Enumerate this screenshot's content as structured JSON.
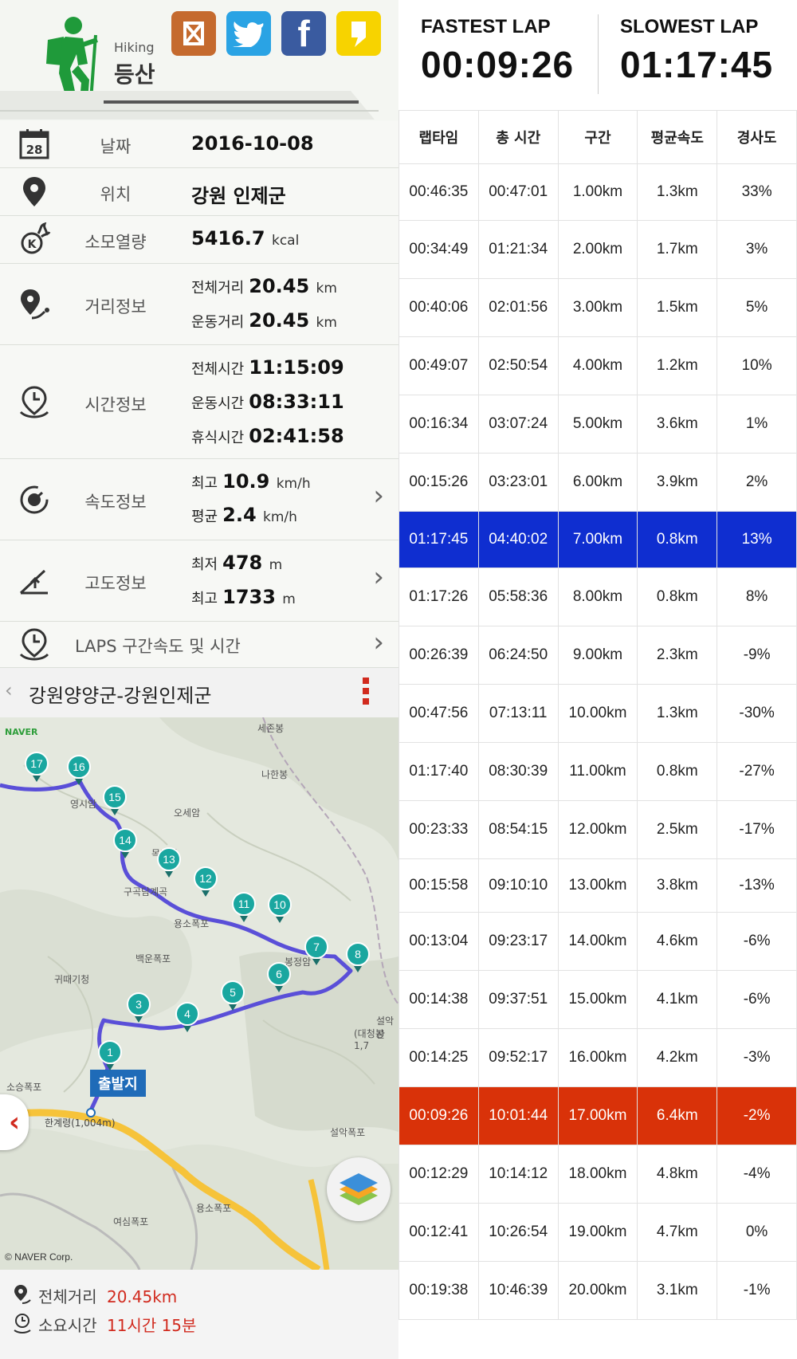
{
  "header": {
    "en_label": "Hiking",
    "ko_label": "등산"
  },
  "info": {
    "date": {
      "label": "날짜",
      "value": "2016-10-08",
      "cal_day": "28"
    },
    "location": {
      "label": "위치",
      "value": "강원 인제군"
    },
    "calories": {
      "label": "소모열량",
      "value": "5416.7",
      "unit": "kcal"
    },
    "distance": {
      "label": "거리정보",
      "total_label": "전체거리",
      "total": "20.45",
      "move_label": "운동거리",
      "move": "20.45",
      "unit": "km"
    },
    "time": {
      "label": "시간정보",
      "total_label": "전체시간",
      "total": "11:15:09",
      "move_label": "운동시간",
      "move": "08:33:11",
      "rest_label": "휴식시간",
      "rest": "02:41:58"
    },
    "speed": {
      "label": "속도정보",
      "max_label": "최고",
      "max": "10.9",
      "avg_label": "평균",
      "avg": "2.4",
      "unit": "km/h"
    },
    "altitude": {
      "label": "고도정보",
      "min_label": "최저",
      "min": "478",
      "max_label": "최고",
      "max": "1733",
      "unit": "m"
    },
    "laps_link": "LAPS 구간속도 및 시간"
  },
  "map": {
    "title": "강원양양군-강원인제군",
    "naver_logo": "NAVER",
    "copyright": "© NAVER Corp.",
    "start_label": "출발지",
    "start_point": "한계령(1,004m)",
    "place_labels": [
      "세존봉",
      "나한봉",
      "오세암",
      "영시암",
      "목녀봉",
      "구곡담계곡",
      "용소폭포",
      "봉정암",
      "백운폭포",
      "귀때기청",
      "설악산",
      "(대청봉1,7",
      "소승폭포",
      "설악폭포",
      "여심폭포",
      "용소폭포"
    ],
    "markers": [
      "1",
      "3",
      "4",
      "5",
      "6",
      "7",
      "8",
      "10",
      "11",
      "12",
      "13",
      "14",
      "15",
      "16",
      "17"
    ],
    "footer_distance_label": "전체거리",
    "footer_distance": "20.45km",
    "footer_time_label": "소요시간",
    "footer_time": "11시간 15분"
  },
  "laps": {
    "fastest_label": "FASTEST LAP",
    "fastest": "00:09:26",
    "slowest_label": "SLOWEST LAP",
    "slowest": "01:17:45",
    "columns": [
      "랩타임",
      "총 시간",
      "구간",
      "평균속도",
      "경사도"
    ],
    "rows": [
      [
        "00:46:35",
        "00:47:01",
        "1.00km",
        "1.3km",
        "33%"
      ],
      [
        "00:34:49",
        "01:21:34",
        "2.00km",
        "1.7km",
        "3%"
      ],
      [
        "00:40:06",
        "02:01:56",
        "3.00km",
        "1.5km",
        "5%"
      ],
      [
        "00:49:07",
        "02:50:54",
        "4.00km",
        "1.2km",
        "10%"
      ],
      [
        "00:16:34",
        "03:07:24",
        "5.00km",
        "3.6km",
        "1%"
      ],
      [
        "00:15:26",
        "03:23:01",
        "6.00km",
        "3.9km",
        "2%"
      ],
      [
        "01:17:45",
        "04:40:02",
        "7.00km",
        "0.8km",
        "13%"
      ],
      [
        "01:17:26",
        "05:58:36",
        "8.00km",
        "0.8km",
        "8%"
      ],
      [
        "00:26:39",
        "06:24:50",
        "9.00km",
        "2.3km",
        "-9%"
      ],
      [
        "00:47:56",
        "07:13:11",
        "10.00km",
        "1.3km",
        "-30%"
      ],
      [
        "01:17:40",
        "08:30:39",
        "11.00km",
        "0.8km",
        "-27%"
      ],
      [
        "00:23:33",
        "08:54:15",
        "12.00km",
        "2.5km",
        "-17%"
      ],
      [
        "00:15:58",
        "09:10:10",
        "13.00km",
        "3.8km",
        "-13%"
      ],
      [
        "00:13:04",
        "09:23:17",
        "14.00km",
        "4.6km",
        "-6%"
      ],
      [
        "00:14:38",
        "09:37:51",
        "15.00km",
        "4.1km",
        "-6%"
      ],
      [
        "00:14:25",
        "09:52:17",
        "16.00km",
        "4.2km",
        "-3%"
      ],
      [
        "00:09:26",
        "10:01:44",
        "17.00km",
        "6.4km",
        "-2%"
      ],
      [
        "00:12:29",
        "10:14:12",
        "18.00km",
        "4.8km",
        "-4%"
      ],
      [
        "00:12:41",
        "10:26:54",
        "19.00km",
        "4.7km",
        "0%"
      ],
      [
        "00:19:38",
        "10:46:39",
        "20.00km",
        "3.1km",
        "-1%"
      ]
    ],
    "slowest_row_index": 6,
    "fastest_row_index": 16
  },
  "colors": {
    "hiker_green": "#1f9a3a",
    "slow_highlight": "#0f2ed0",
    "fast_highlight": "#d93209",
    "route": "#5a4fd8",
    "marker": "#1aa7a0",
    "accent_red": "#d12a1e"
  }
}
